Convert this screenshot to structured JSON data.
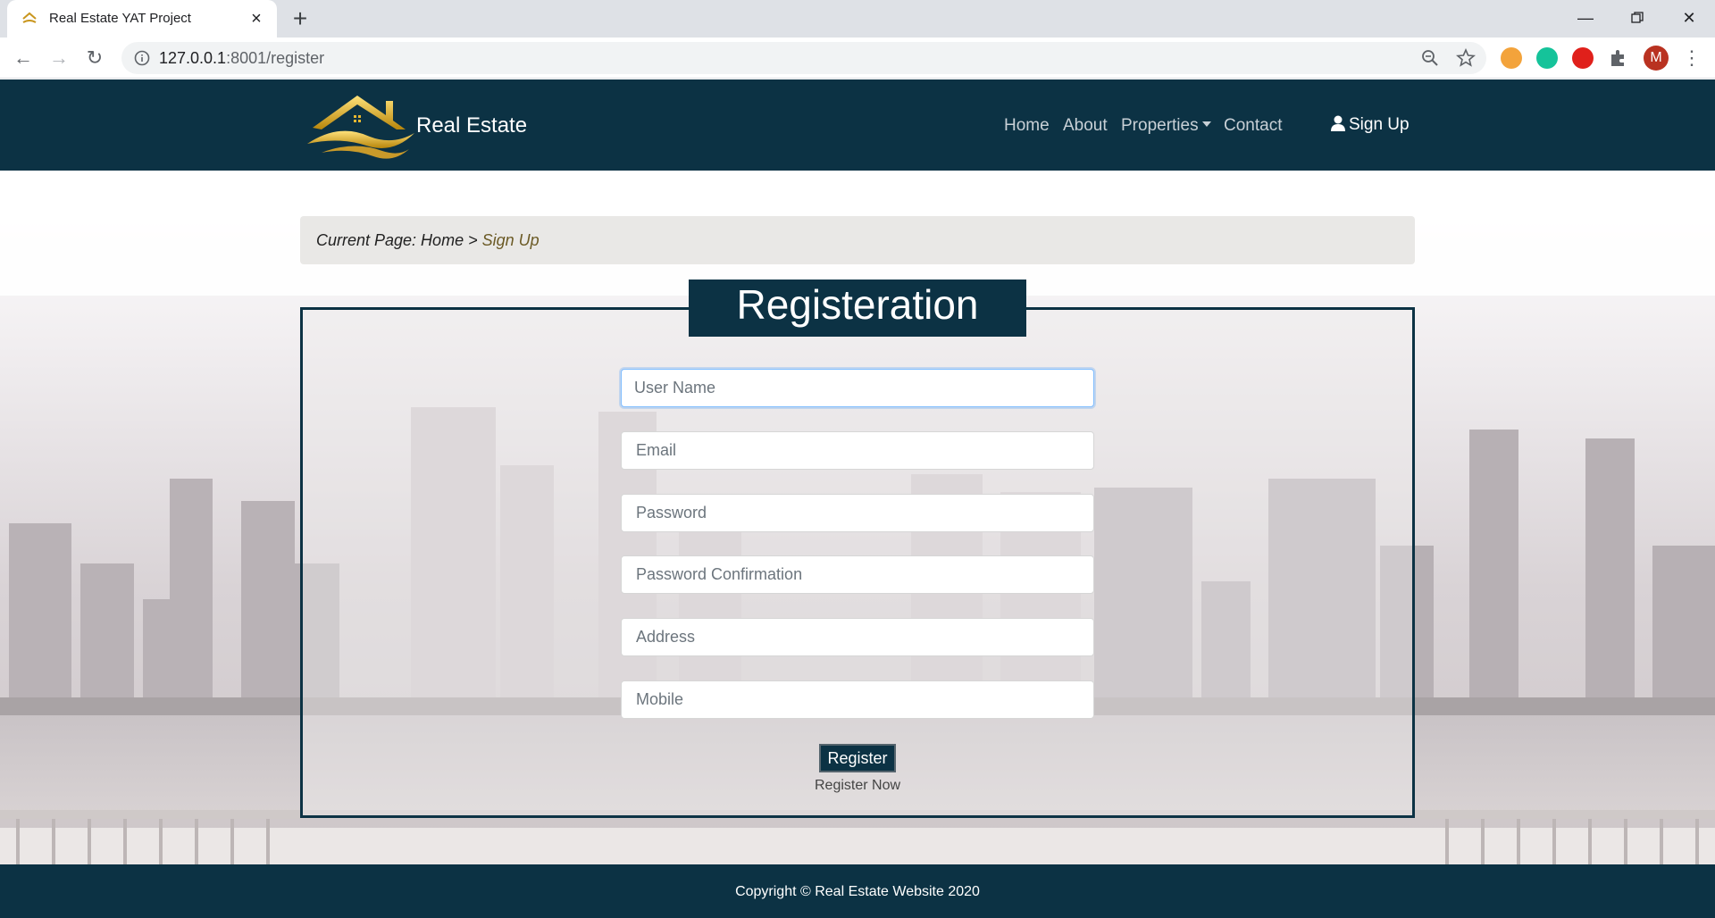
{
  "browser": {
    "tab_title": "Real Estate YAT Project",
    "url_host": "127.0.0.1",
    "url_rest": ":8001/register",
    "avatar_letter": "M"
  },
  "navbar": {
    "brand": "Real Estate",
    "links": [
      "Home",
      "About",
      "Properties",
      "Contact"
    ],
    "signup": "Sign Up",
    "colors": {
      "nav_bg": "#0c3244",
      "link": "#c8d0d6"
    }
  },
  "breadcrumb": {
    "prefix": "Current Page: Home >",
    "current": "Sign Up"
  },
  "form": {
    "title": "Registeration",
    "placeholders": {
      "username": "User Name",
      "email": "Email",
      "password": "Password",
      "password_confirmation": "Password Confirmation",
      "address": "Address",
      "mobile": "Mobile"
    },
    "submit": "Register",
    "register_now": "Register Now"
  },
  "footer": {
    "copyright": "Copyright © Real Estate Website 2020"
  }
}
